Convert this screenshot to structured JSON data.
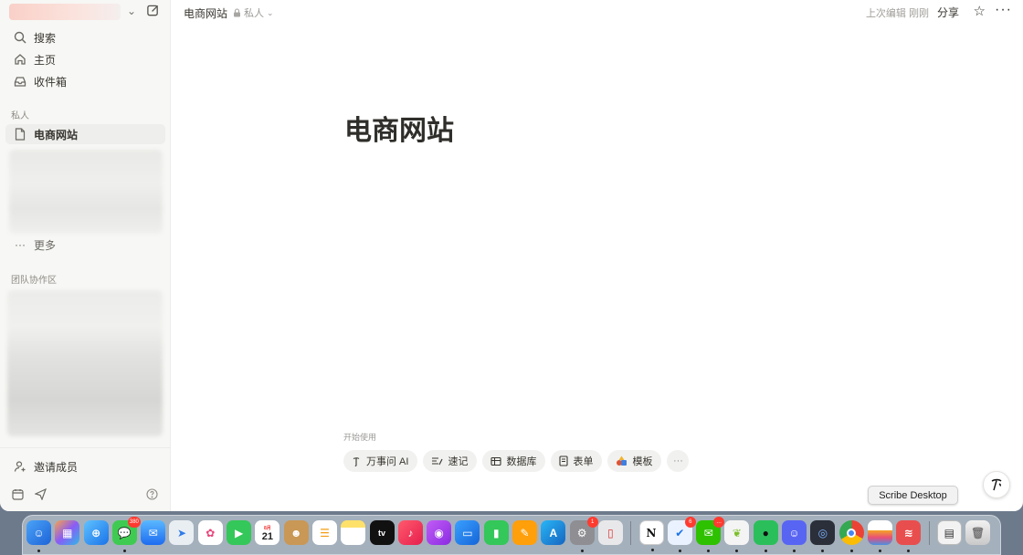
{
  "sidebar": {
    "nav": [
      {
        "label": "搜索",
        "icon": "search-icon"
      },
      {
        "label": "主页",
        "icon": "home-icon"
      },
      {
        "label": "收件箱",
        "icon": "inbox-icon"
      }
    ],
    "private_section": "私人",
    "active_page": "电商网站",
    "more_label": "更多",
    "team_section": "团队协作区",
    "invite_label": "邀请成员"
  },
  "topbar": {
    "breadcrumb": "电商网站",
    "privacy": "私人",
    "last_edited": "上次编辑 刚刚",
    "share": "分享"
  },
  "page": {
    "title": "电商网站",
    "start_label": "开始使用",
    "chips": [
      {
        "label": "万事问 AI",
        "icon": "ai-icon"
      },
      {
        "label": "速记",
        "icon": "notes-icon"
      },
      {
        "label": "数据库",
        "icon": "table-icon"
      },
      {
        "label": "表单",
        "icon": "form-icon"
      },
      {
        "label": "模板",
        "icon": "templates-icon"
      }
    ]
  },
  "tooltip": "Scribe Desktop",
  "dock": {
    "calendar_day": "21",
    "calendar_month": "8月",
    "badges": {
      "messages": "380",
      "settings": "1",
      "mail2": "6",
      "wechat": "…"
    }
  }
}
